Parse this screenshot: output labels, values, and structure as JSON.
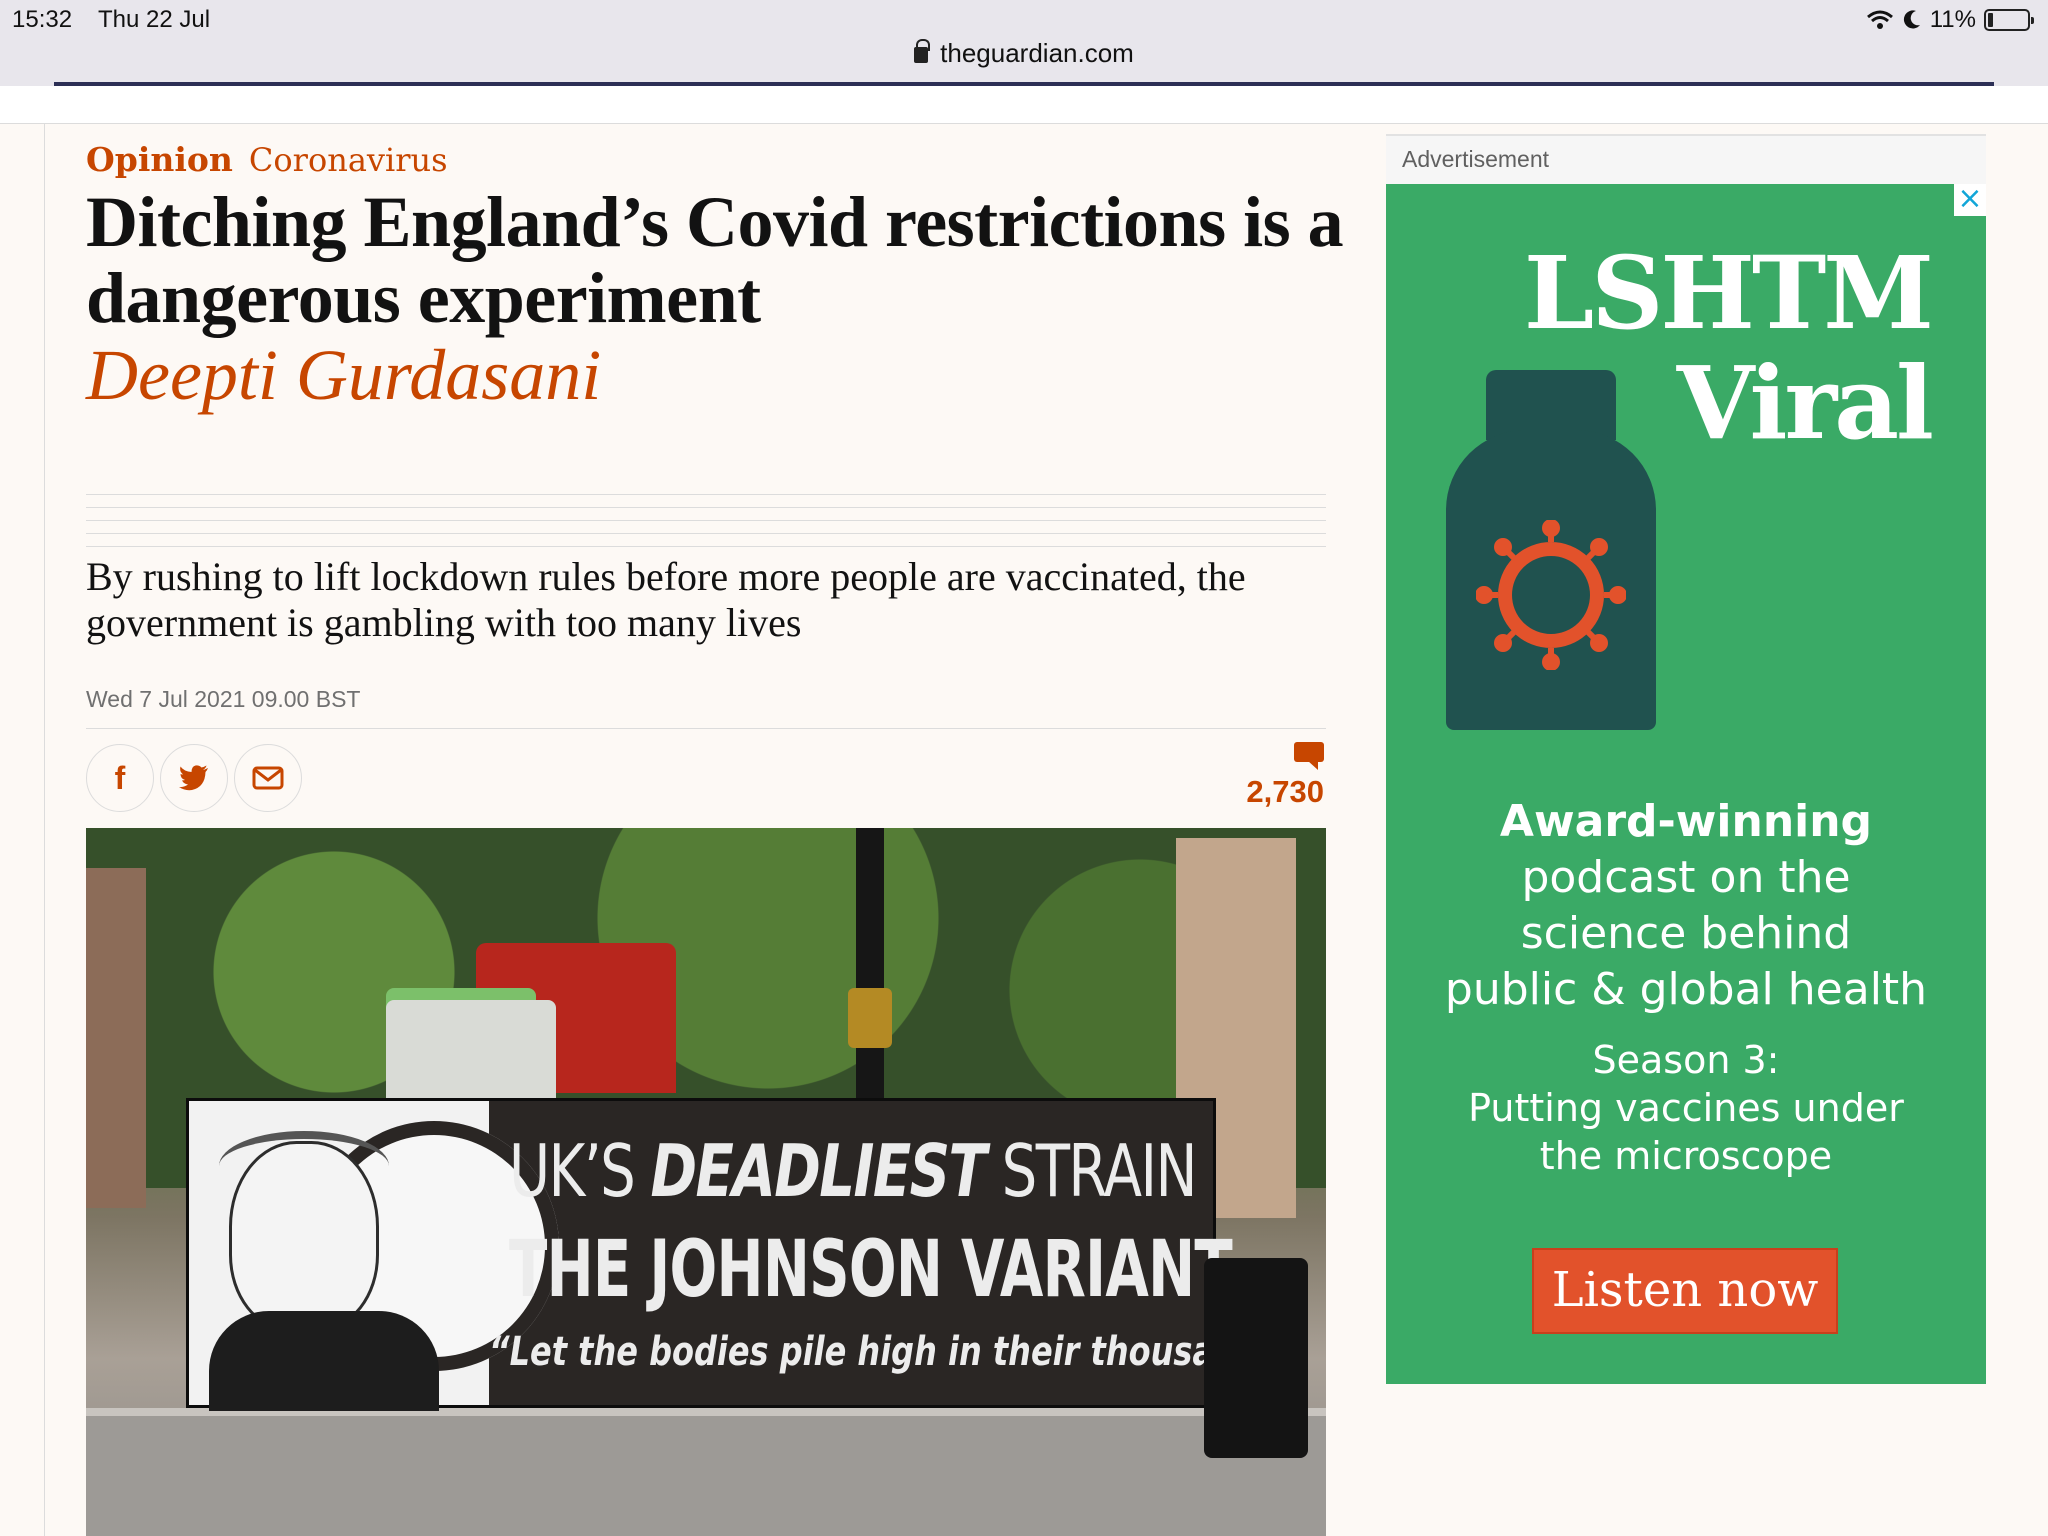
{
  "status_bar": {
    "time": "15:32",
    "date": "Thu 22 Jul",
    "battery": "11%"
  },
  "browser": {
    "url": "theguardian.com"
  },
  "article": {
    "kicker_opinion": "Opinion",
    "kicker_section": "Coronavirus",
    "headline": "Ditching England’s Covid restrictions is a dangerous experiment",
    "byline": "Deepti Gurdasani",
    "standfirst": "By rushing to lift lockdown rules before more people are vaccinated, the government is gambling with too many lives",
    "dateline": "Wed 7 Jul 2021 09.00 BST",
    "share": {
      "facebook_icon": "f",
      "twitter_icon": "twitter-bird",
      "email_icon": "envelope"
    },
    "comment_count": "2,730",
    "photo": {
      "banner_line1_light": "UK’S ",
      "banner_line1_bold": "DEADLIEST",
      "banner_line1_end": " STRAIN",
      "banner_line2": "THE JOHNSON VARIANT",
      "banner_line3": "“Let the bodies pile high in their thousands”"
    }
  },
  "advert": {
    "label": "Advertisement",
    "close": "×",
    "brand_line1": "LSHTM",
    "brand_line2": "Viral",
    "award": "Award-winning",
    "desc_line1": "podcast on the",
    "desc_line2": "science behind",
    "desc_line3": "public & global health",
    "season_line1": "Season 3:",
    "season_line2": "Putting vaccines under",
    "season_line3": "the  microscope",
    "cta": "Listen now"
  },
  "colors": {
    "guardian_orange": "#c74600",
    "ad_green": "#3aaa66",
    "ad_cta": "#e2522b",
    "bottle": "#20524f"
  }
}
